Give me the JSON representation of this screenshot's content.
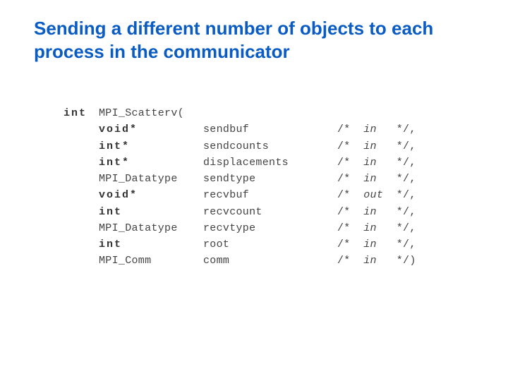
{
  "title": "Sending a different number of objects to each process in the communicator",
  "signature": {
    "return_kw": "int",
    "fn": "MPI_Scatterv(",
    "params": [
      {
        "type": "void*",
        "kw": true,
        "name": "sendbuf",
        "dir": "in",
        "tail": "*/,"
      },
      {
        "type": "int*",
        "kw": true,
        "name": "sendcounts",
        "dir": "in",
        "tail": "*/,"
      },
      {
        "type": "int*",
        "kw": true,
        "name": "displacements",
        "dir": "in",
        "tail": "*/,"
      },
      {
        "type": "MPI_Datatype",
        "kw": false,
        "name": "sendtype",
        "dir": "in",
        "tail": "*/,"
      },
      {
        "type": "void*",
        "kw": true,
        "name": "recvbuf",
        "dir": "out",
        "tail": "*/,"
      },
      {
        "type": "int",
        "kw": true,
        "name": "recvcount",
        "dir": "in",
        "tail": "*/,"
      },
      {
        "type": "MPI_Datatype",
        "kw": false,
        "name": "recvtype",
        "dir": "in",
        "tail": "*/,"
      },
      {
        "type": "int",
        "kw": true,
        "name": "root",
        "dir": "in",
        "tail": "*/,"
      },
      {
        "type": "MPI_Comm",
        "kw": false,
        "name": "comm",
        "dir": "in",
        "tail": "*/)"
      }
    ]
  }
}
